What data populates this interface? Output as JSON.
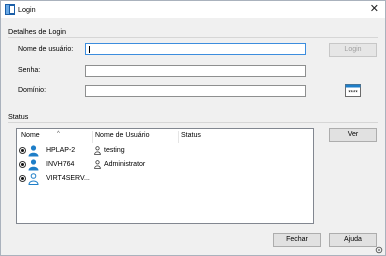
{
  "window": {
    "title": "Login"
  },
  "login_details": {
    "section_title": "Detalhes de Login",
    "username_label": "Nome de usuário:",
    "username_value": "",
    "password_label": "Senha:",
    "password_value": "",
    "domain_label": "Domínio:",
    "domain_value": "",
    "login_button": "Login",
    "keyboard_icon": "password-keyboard-icon"
  },
  "status": {
    "section_title": "Status",
    "columns": [
      "Nome",
      "Nome de Usuário",
      "Status"
    ],
    "rows": [
      {
        "name": "HPLAP-2",
        "user": "testing",
        "status": "",
        "icon": "computer-user-icon"
      },
      {
        "name": "INVH764",
        "user": "Administrator",
        "status": "",
        "icon": "computer-user-icon"
      },
      {
        "name": "VIRT4SERV...",
        "user": "",
        "status": "",
        "icon": "computer-user-outline-icon"
      }
    ],
    "view_button": "Ver"
  },
  "footer": {
    "close_button": "Fechar",
    "help_button": "Ajuda"
  },
  "colors": {
    "accent": "#1e7ec8",
    "focus_border": "#3c8dde"
  }
}
